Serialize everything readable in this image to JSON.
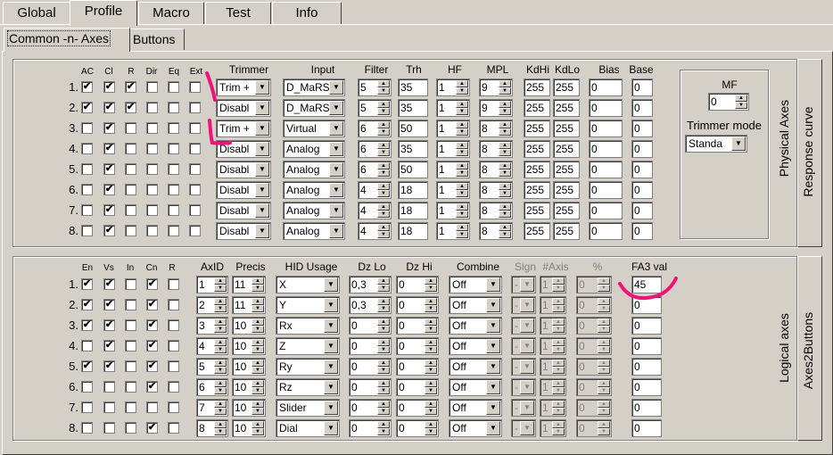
{
  "main_tabs": [
    "Global",
    "Profile",
    "Macro",
    "Test",
    "Info"
  ],
  "active_main_tab": "Profile",
  "sub_tabs": [
    "Common -n- Axes",
    "Buttons"
  ],
  "active_sub_tab": "Common -n- Axes",
  "physical": {
    "side_label": "Physical Axes",
    "side_tab": "Response curve",
    "headers": {
      "ac": "AC",
      "cl": "Cl",
      "r": "R",
      "dir": "Dir",
      "eq": "Eq",
      "ext": "Ext",
      "trimmer": "Trimmer",
      "input": "Input",
      "filter": "Filter",
      "trh": "Trh",
      "hf": "HF",
      "mpl": "MPL",
      "kdhi": "KdHi",
      "kdlo": "KdLo",
      "bias": "Bias",
      "base": "Base"
    },
    "rows": [
      {
        "n": "1.",
        "ac": true,
        "cl": true,
        "r": true,
        "dir": false,
        "eq": false,
        "ext": false,
        "trimmer": "Trim +",
        "input": "D_MaRS",
        "filter": "5",
        "trh": "35",
        "hf": "1",
        "mpl": "9",
        "kdhi": "255",
        "kdlo": "255",
        "bias": "0",
        "base": "0"
      },
      {
        "n": "2.",
        "ac": true,
        "cl": true,
        "r": true,
        "dir": false,
        "eq": false,
        "ext": false,
        "trimmer": "Disabl",
        "input": "D_MaRS",
        "filter": "5",
        "trh": "35",
        "hf": "1",
        "mpl": "9",
        "kdhi": "255",
        "kdlo": "255",
        "bias": "0",
        "base": "0"
      },
      {
        "n": "3.",
        "ac": false,
        "cl": true,
        "r": false,
        "dir": false,
        "eq": false,
        "ext": false,
        "trimmer": "Trim +",
        "input": "Virtual",
        "filter": "6",
        "trh": "50",
        "hf": "1",
        "mpl": "8",
        "kdhi": "255",
        "kdlo": "255",
        "bias": "0",
        "base": "0"
      },
      {
        "n": "4.",
        "ac": false,
        "cl": true,
        "r": false,
        "dir": false,
        "eq": false,
        "ext": false,
        "trimmer": "Disabl",
        "input": "Analog",
        "filter": "6",
        "trh": "35",
        "hf": "1",
        "mpl": "8",
        "kdhi": "255",
        "kdlo": "255",
        "bias": "0",
        "base": "0"
      },
      {
        "n": "5.",
        "ac": false,
        "cl": true,
        "r": false,
        "dir": false,
        "eq": false,
        "ext": false,
        "trimmer": "Disabl",
        "input": "Analog",
        "filter": "6",
        "trh": "50",
        "hf": "1",
        "mpl": "8",
        "kdhi": "255",
        "kdlo": "255",
        "bias": "0",
        "base": "0"
      },
      {
        "n": "6.",
        "ac": false,
        "cl": true,
        "r": false,
        "dir": false,
        "eq": false,
        "ext": false,
        "trimmer": "Disabl",
        "input": "Analog",
        "filter": "4",
        "trh": "18",
        "hf": "1",
        "mpl": "8",
        "kdhi": "255",
        "kdlo": "255",
        "bias": "0",
        "base": "0"
      },
      {
        "n": "7.",
        "ac": false,
        "cl": true,
        "r": false,
        "dir": false,
        "eq": false,
        "ext": false,
        "trimmer": "Disabl",
        "input": "Analog",
        "filter": "4",
        "trh": "18",
        "hf": "1",
        "mpl": "8",
        "kdhi": "255",
        "kdlo": "255",
        "bias": "0",
        "base": "0"
      },
      {
        "n": "8.",
        "ac": false,
        "cl": true,
        "r": false,
        "dir": false,
        "eq": false,
        "ext": false,
        "trimmer": "Disabl",
        "input": "Analog",
        "filter": "4",
        "trh": "18",
        "hf": "1",
        "mpl": "8",
        "kdhi": "255",
        "kdlo": "255",
        "bias": "0",
        "base": "0"
      }
    ],
    "mf_label": "MF",
    "mf_value": "0",
    "trimmer_mode_label": "Trimmer mode",
    "trimmer_mode_value": "Standa"
  },
  "logical": {
    "side_label": "Logical axes",
    "side_tab": "Axes2Buttons",
    "headers": {
      "en": "En",
      "vs": "Vs",
      "in": "In",
      "cn": "Cn",
      "r": "R",
      "axid": "AxID",
      "precis": "Precis",
      "hid": "HID Usage",
      "dzlo": "Dz Lo",
      "dzhi": "Dz Hi",
      "combine": "Combine",
      "sign": "Sign",
      "naxis": "#Axis",
      "pct": "%",
      "fa3": "FA3 val"
    },
    "rows": [
      {
        "n": "1.",
        "en": true,
        "vs": true,
        "in": false,
        "cn": true,
        "r": false,
        "axid": "1",
        "precis": "11",
        "hid": "X",
        "dzlo": "0,3",
        "dzhi": "0",
        "combine": "Off",
        "sign": "-",
        "naxis": "1",
        "pct": "0",
        "fa3": "45"
      },
      {
        "n": "2.",
        "en": true,
        "vs": true,
        "in": false,
        "cn": true,
        "r": false,
        "axid": "2",
        "precis": "11",
        "hid": "Y",
        "dzlo": "0,3",
        "dzhi": "0",
        "combine": "Off",
        "sign": "-",
        "naxis": "1",
        "pct": "0",
        "fa3": "0"
      },
      {
        "n": "3.",
        "en": true,
        "vs": true,
        "in": false,
        "cn": true,
        "r": false,
        "axid": "3",
        "precis": "10",
        "hid": "Rx",
        "dzlo": "0",
        "dzhi": "0",
        "combine": "Off",
        "sign": "-",
        "naxis": "1",
        "pct": "0",
        "fa3": "0"
      },
      {
        "n": "4.",
        "en": false,
        "vs": true,
        "in": false,
        "cn": true,
        "r": false,
        "axid": "4",
        "precis": "10",
        "hid": "Z",
        "dzlo": "0",
        "dzhi": "0",
        "combine": "Off",
        "sign": "-",
        "naxis": "1",
        "pct": "0",
        "fa3": "0"
      },
      {
        "n": "5.",
        "en": true,
        "vs": true,
        "in": false,
        "cn": true,
        "r": false,
        "axid": "5",
        "precis": "10",
        "hid": "Ry",
        "dzlo": "0",
        "dzhi": "0",
        "combine": "Off",
        "sign": "-",
        "naxis": "1",
        "pct": "0",
        "fa3": "0"
      },
      {
        "n": "6.",
        "en": false,
        "vs": false,
        "in": false,
        "cn": true,
        "r": false,
        "axid": "6",
        "precis": "10",
        "hid": "Rz",
        "dzlo": "0",
        "dzhi": "0",
        "combine": "Off",
        "sign": "-",
        "naxis": "1",
        "pct": "0",
        "fa3": "0"
      },
      {
        "n": "7.",
        "en": false,
        "vs": false,
        "in": false,
        "cn": false,
        "r": false,
        "axid": "7",
        "precis": "10",
        "hid": "Slider",
        "dzlo": "0",
        "dzhi": "0",
        "combine": "Off",
        "sign": "-",
        "naxis": "1",
        "pct": "0",
        "fa3": "0"
      },
      {
        "n": "8.",
        "en": false,
        "vs": false,
        "in": false,
        "cn": true,
        "r": false,
        "axid": "8",
        "precis": "10",
        "hid": "Dial",
        "dzlo": "0",
        "dzhi": "0",
        "combine": "Off",
        "sign": "-",
        "naxis": "1",
        "pct": "0",
        "fa3": "0"
      }
    ]
  },
  "annotation_color": "#f0147a"
}
